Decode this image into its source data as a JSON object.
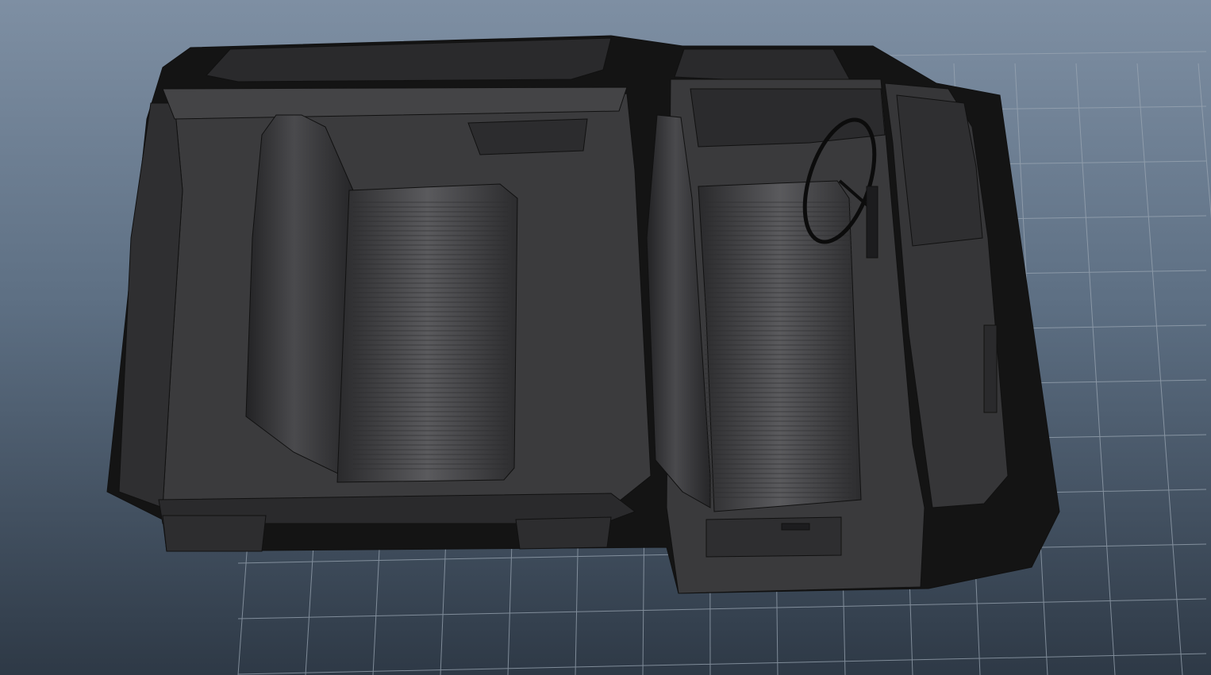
{
  "viewport": {
    "label": "",
    "background_top": "#7e8fa3",
    "background_bottom": "#2e3946",
    "grid_color": "#9aa6b3",
    "model_color": "#3a3a3c",
    "wire_color": "#111111"
  },
  "model": {
    "parts": [
      "body-shell",
      "rear-bench-seat",
      "front-bench-seat",
      "dashboard",
      "steering-wheel",
      "door-panel",
      "floor"
    ]
  }
}
